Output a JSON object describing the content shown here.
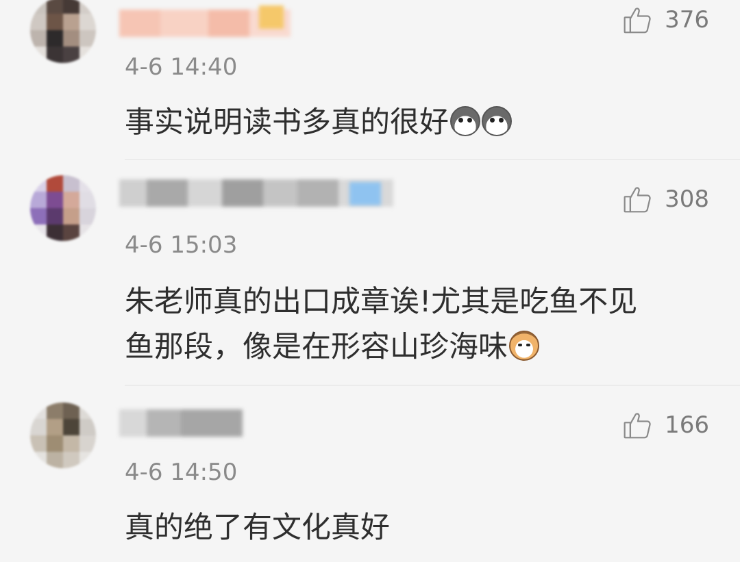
{
  "comments": [
    {
      "likes": "376",
      "time": "4-6 14:40",
      "text": "事实说明读书多真的很好",
      "emojis": [
        "husky-emoji",
        "husky-emoji"
      ]
    },
    {
      "likes": "308",
      "time": "4-6 15:03",
      "text_line1": "朱老师真的出口成章诶!尤其是吃鱼不见",
      "text_line2": "鱼那段，像是在形容山珍海味",
      "emojis": [
        "cat-emoji"
      ]
    },
    {
      "likes": "166",
      "time": "4-6 14:50",
      "text": "真的绝了有文化真好"
    }
  ],
  "icons": {
    "like": "thumbs-up-icon"
  },
  "colors": {
    "background": "#f5f5f5",
    "text": "#2e2e2e",
    "meta": "#8a8a8a"
  }
}
